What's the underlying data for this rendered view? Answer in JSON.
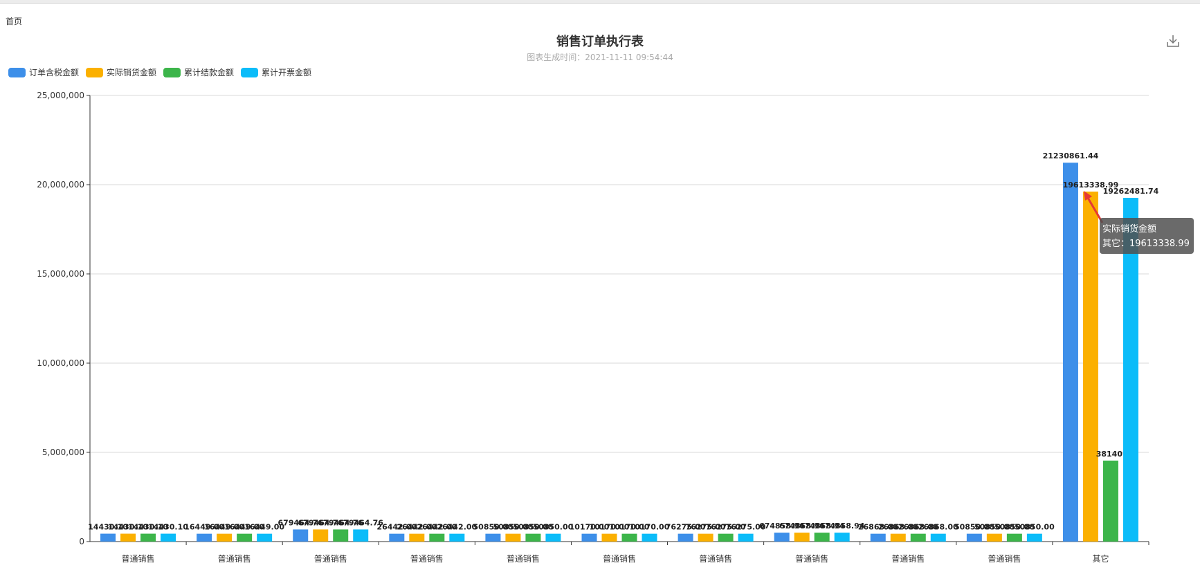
{
  "breadcrumb": "首页",
  "chart_data": {
    "type": "bar",
    "title": "销售订单执行表",
    "subtitle": "图表生成时间：2021-11-11 09:54:44",
    "categories": [
      "普通销售",
      "普通销售",
      "普通销售",
      "普通销售",
      "普通销售",
      "普通销售",
      "普通销售",
      "普通销售",
      "普通销售",
      "普通销售",
      "其它"
    ],
    "ylim": [
      0,
      25000000
    ],
    "yticks": [
      "0",
      "5,000,000",
      "10,000,000",
      "15,000,000",
      "20,000,000",
      "25,000,000"
    ],
    "grid": true,
    "legend_position": "top-left",
    "series": [
      {
        "name": "订单含税金额",
        "color": "#3d8fe9",
        "values": [
          443000,
          440000,
          680000,
          440000,
          440000,
          440000,
          440000,
          500000,
          440000,
          440000,
          21230861.44
        ],
        "labels": [
          "14430.10",
          "16449.00",
          "679464.76",
          "26442.00",
          "50850.00",
          "10170.00",
          "76275.00",
          "674858.94",
          "26868.00",
          "50850.00",
          "21230861.44"
        ]
      },
      {
        "name": "实际销货金额",
        "color": "#fbb000",
        "values": [
          443000,
          440000,
          680000,
          440000,
          440000,
          440000,
          440000,
          500000,
          440000,
          440000,
          19613338.99
        ],
        "labels": [
          "14430.10",
          "16449.00",
          "679464.76",
          "26442.00",
          "50850.00",
          "10170.00",
          "76275.00",
          "674858.94",
          "26868.00",
          "50850.00",
          "19613338.99"
        ]
      },
      {
        "name": "累计结款金额",
        "color": "#3cb54a",
        "values": [
          443000,
          440000,
          680000,
          440000,
          440000,
          440000,
          440000,
          500000,
          440000,
          440000,
          4538140
        ],
        "labels": [
          "14430.10",
          "16449.00",
          "679464.76",
          "26442.00",
          "50850.00",
          "10170.00",
          "76275.00",
          "674858.94",
          "26868.00",
          "50850.00",
          "38140."
        ]
      },
      {
        "name": "累计开票金额",
        "color": "#0bbcf9",
        "values": [
          443000,
          440000,
          680000,
          440000,
          440000,
          440000,
          440000,
          500000,
          440000,
          440000,
          19262481.74
        ],
        "labels": [
          "14430.10",
          "16449.00",
          "679464.76",
          "26442.00",
          "50850.00",
          "10170.00",
          "76275.00",
          "674858.94",
          "26868.00",
          "50850.00",
          "19262481.74"
        ]
      }
    ],
    "tooltip": {
      "series": "实际销货金额",
      "line": "其它：19613338.99"
    }
  }
}
